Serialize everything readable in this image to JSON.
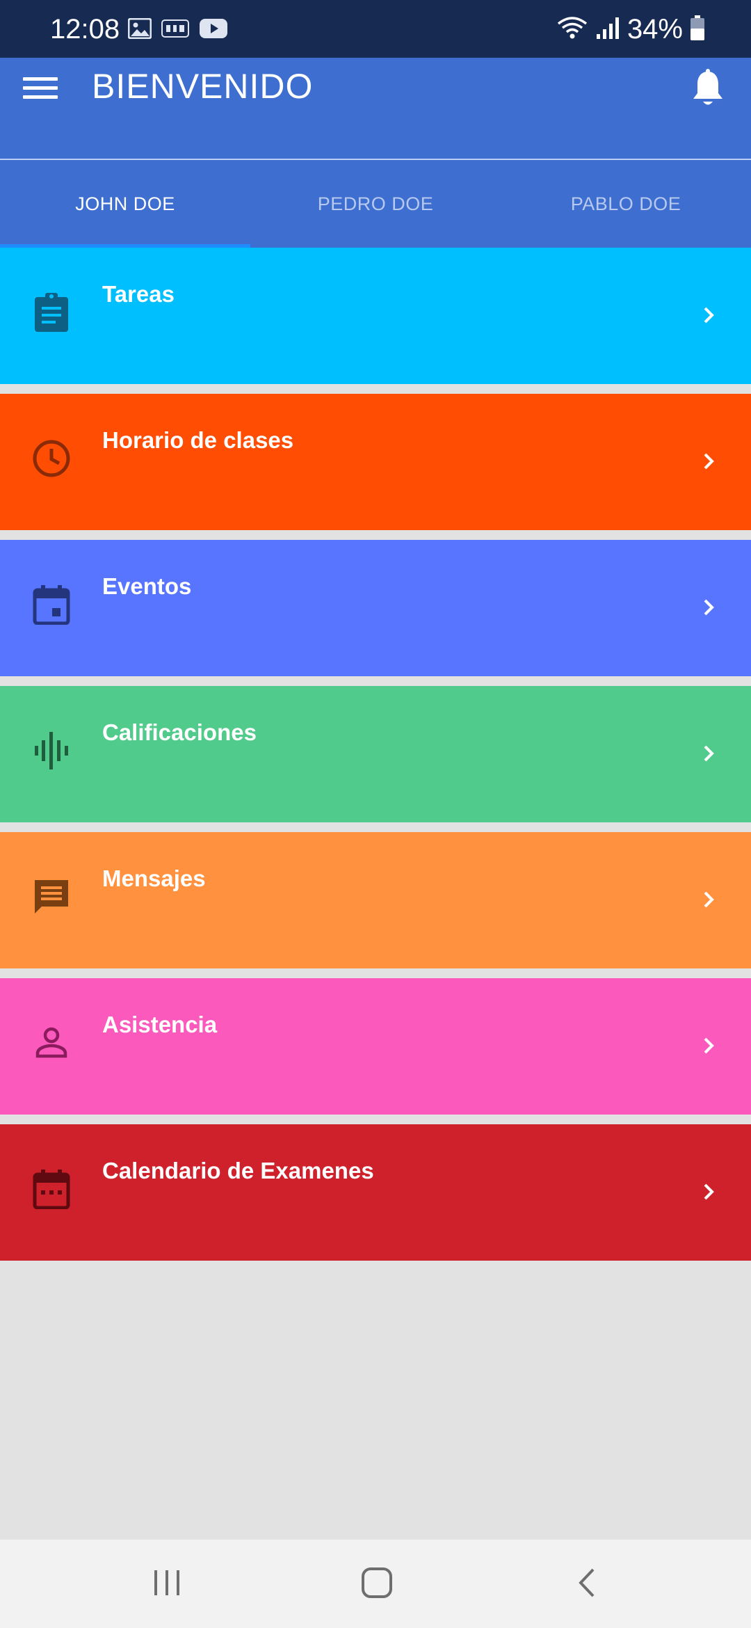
{
  "status_bar": {
    "time": "12:08",
    "battery": "34%",
    "notification_icons": [
      "image-icon",
      "cnet-icon",
      "youtube-icon"
    ],
    "system_icons": [
      "wifi-icon",
      "signal-icon",
      "battery-icon"
    ]
  },
  "app_bar": {
    "title": "BIENVENIDO",
    "menu_icon": "hamburger-menu-icon",
    "notification_icon": "bell-icon",
    "color": "#3e6fd0"
  },
  "tabs": [
    {
      "label": "JOHN DOE",
      "selected": true
    },
    {
      "label": "PEDRO DOE",
      "selected": false
    },
    {
      "label": "PABLO DOE",
      "selected": false
    }
  ],
  "menu": [
    {
      "label": "Tareas",
      "icon": "clipboard-icon",
      "color": "#00bfff",
      "icon_color": "#0d5f84"
    },
    {
      "label": "Horario de clases",
      "icon": "clock-icon",
      "color": "#ff4d04",
      "icon_color": "#8a2a06"
    },
    {
      "label": "Eventos",
      "icon": "calendar-event-icon",
      "color": "#5875ff",
      "icon_color": "#24357d"
    },
    {
      "label": "Calificaciones",
      "icon": "equalizer-icon",
      "color": "#51cb8b",
      "icon_color": "#1f5e3d"
    },
    {
      "label": "Mensajes",
      "icon": "message-icon",
      "color": "#ff913f",
      "icon_color": "#7a3f10"
    },
    {
      "label": "Asistencia",
      "icon": "person-icon",
      "color": "#fb5abc",
      "icon_color": "#8a1c5e"
    },
    {
      "label": "Calendario de Examenes",
      "icon": "calendar-icon",
      "color": "#ce212c",
      "icon_color": "#5e0a10"
    }
  ],
  "nav_bar": {
    "buttons": [
      "recent-apps-icon",
      "home-icon",
      "back-icon"
    ]
  }
}
